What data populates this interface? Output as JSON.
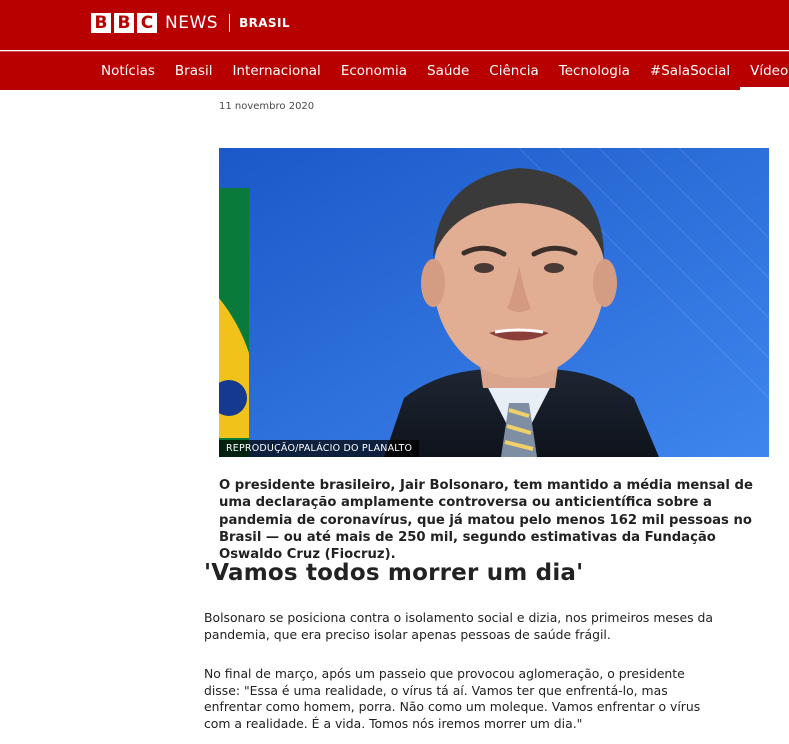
{
  "brand": {
    "letters": [
      "B",
      "B",
      "C"
    ],
    "news": "NEWS",
    "edition": "BRASIL"
  },
  "nav": [
    {
      "label": "Notícias"
    },
    {
      "label": "Brasil"
    },
    {
      "label": "Internacional"
    },
    {
      "label": "Economia"
    },
    {
      "label": "Saúde"
    },
    {
      "label": "Ciência"
    },
    {
      "label": "Tecnologia"
    },
    {
      "label": "#SalaSocial"
    },
    {
      "label": "Vídeos",
      "active": true
    }
  ],
  "article": {
    "date": "11 novembro 2020",
    "image_credit": "REPRODUÇÃO/PALÁCIO DO PLANALTO",
    "lead": "O presidente brasileiro, Jair Bolsonaro, tem mantido a média mensal de uma declaração amplamente controversa ou anticientífica sobre a pandemia de coronavírus, que já matou pelo menos 162 mil pessoas no Brasil — ou até mais de 250 mil, segundo estimativas da Fundação Oswaldo Cruz (Fiocruz).",
    "subheading": "'Vamos todos morrer um dia'",
    "paragraphs": [
      "Bolsonaro se posiciona contra o isolamento social e dizia, nos primeiros meses da pandemia, que era preciso isolar apenas pessoas de saúde frágil.",
      "No final de março, após um passeio que provocou aglomeração, o presidente disse: \"Essa é uma realidade, o vírus tá aí. Vamos ter que enfrentá-lo, mas enfrentar como homem, porra. Não como um moleque. Vamos enfrentar o vírus com a realidade. É a vida. Tomos nós iremos morrer um dia.\""
    ]
  },
  "colors": {
    "brand_red": "#b80000",
    "text": "#222222",
    "muted": "#4a4a4a"
  }
}
